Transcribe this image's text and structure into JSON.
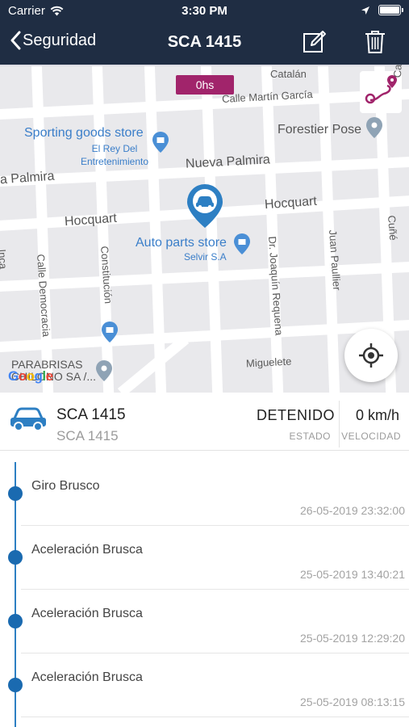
{
  "status_bar": {
    "carrier": "Carrier",
    "time": "3:30 PM",
    "battery_level": 1.0
  },
  "nav": {
    "back_label": "Seguridad",
    "title": "SCA 1415"
  },
  "map": {
    "time_chip": "0hs",
    "streets": [
      "Calle Martín García",
      "Catalán",
      "Nueva Palmira",
      "a Palmira",
      "Hocquart",
      "Hocquart",
      "Calle Democracia",
      "Constitución",
      "Dr. Joaquín Requena",
      "Juan Paullier",
      "Cuñé",
      "Miguelete",
      "Inca",
      "Carabelas"
    ],
    "pois": [
      {
        "name": "Sporting goods store"
      },
      {
        "name": "El Rey Del Entretenimiento"
      },
      {
        "name": "Forestier Pose"
      },
      {
        "name": "Auto parts store"
      },
      {
        "name": "Selvir S.A"
      },
      {
        "name": "PARABRISAS CHILONO SA /..."
      }
    ],
    "google_logo": "Google"
  },
  "vehicle": {
    "name": "SCA 1415",
    "plate": "SCA 1415",
    "status_value": "DETENIDO",
    "status_label": "ESTADO",
    "speed_value": "0 km/h",
    "speed_label": "VELOCIDAD"
  },
  "events": [
    {
      "title": "Giro Brusco",
      "time": "26-05-2019 23:32:00"
    },
    {
      "title": "Aceleración Brusca",
      "time": "25-05-2019 13:40:21"
    },
    {
      "title": "Aceleración Brusca",
      "time": "25-05-2019 12:29:20"
    },
    {
      "title": "Aceleración Brusca",
      "time": "25-05-2019 08:13:15"
    }
  ],
  "colors": {
    "nav_background": "#1f2d43",
    "accent_blue": "#1a6ab0",
    "time_chip": "#a1246b"
  }
}
